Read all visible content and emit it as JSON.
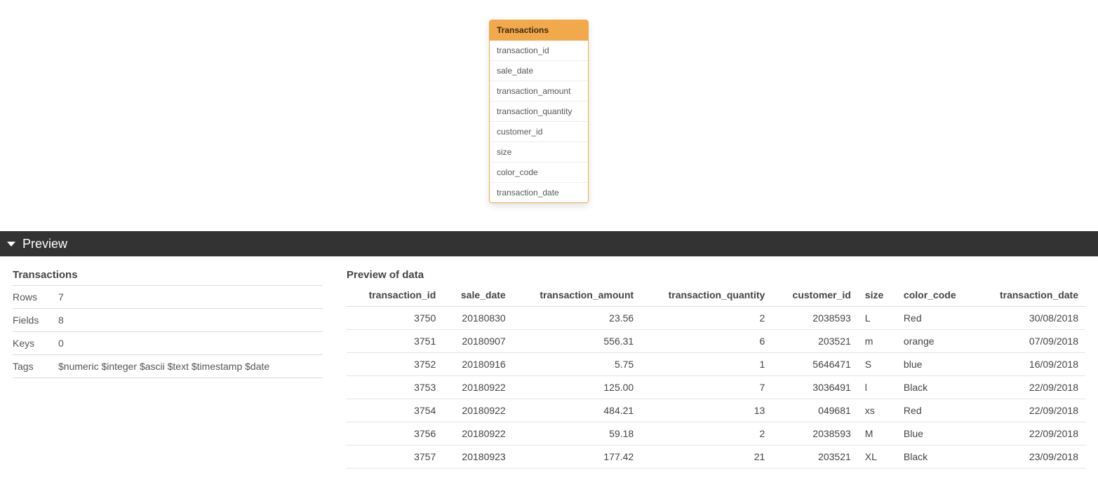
{
  "schema": {
    "title": "Transactions",
    "fields": [
      "transaction_id",
      "sale_date",
      "transaction_amount",
      "transaction_quantity",
      "customer_id",
      "size",
      "color_code",
      "transaction_date"
    ]
  },
  "preview": {
    "header": "Preview",
    "meta": {
      "title": "Transactions",
      "rows_label": "Rows",
      "rows_value": "7",
      "fields_label": "Fields",
      "fields_value": "8",
      "keys_label": "Keys",
      "keys_value": "0",
      "tags_label": "Tags",
      "tags_value": "$numeric $integer $ascii $text $timestamp $date"
    },
    "data": {
      "title": "Preview of data",
      "columns": [
        "transaction_id",
        "sale_date",
        "transaction_amount",
        "transaction_quantity",
        "customer_id",
        "size",
        "color_code",
        "transaction_date"
      ],
      "column_types": [
        "num",
        "num",
        "num",
        "num",
        "num",
        "text",
        "text",
        "num"
      ],
      "rows": [
        [
          "3750",
          "20180830",
          "23.56",
          "2",
          "2038593",
          "L",
          "Red",
          "30/08/2018"
        ],
        [
          "3751",
          "20180907",
          "556.31",
          "6",
          "203521",
          "m",
          "orange",
          "07/09/2018"
        ],
        [
          "3752",
          "20180916",
          "5.75",
          "1",
          "5646471",
          "S",
          "blue",
          "16/09/2018"
        ],
        [
          "3753",
          "20180922",
          "125.00",
          "7",
          "3036491",
          "l",
          "Black",
          "22/09/2018"
        ],
        [
          "3754",
          "20180922",
          "484.21",
          "13",
          "049681",
          "xs",
          "Red",
          "22/09/2018"
        ],
        [
          "3756",
          "20180922",
          "59.18",
          "2",
          "2038593",
          "M",
          "Blue",
          "22/09/2018"
        ],
        [
          "3757",
          "20180923",
          "177.42",
          "21",
          "203521",
          "XL",
          "Black",
          "23/09/2018"
        ]
      ]
    }
  }
}
